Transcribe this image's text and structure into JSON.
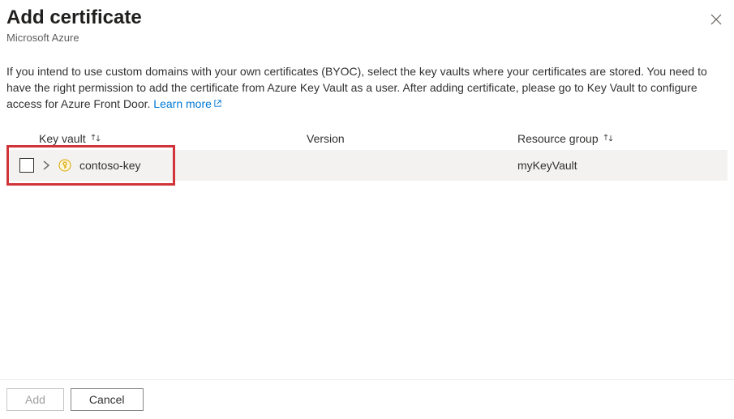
{
  "header": {
    "title": "Add certificate",
    "subtitle": "Microsoft Azure"
  },
  "description": {
    "text": "If you intend to use custom domains with your own certificates (BYOC), select the key vaults where your certificates are stored. You need to have the right permission to add the certificate from Azure Key Vault as a user. After adding certificate, please go to Key Vault to configure access for Azure Front Door. ",
    "link_label": "Learn more"
  },
  "table": {
    "columns": {
      "key_vault": "Key vault",
      "version": "Version",
      "resource_group": "Resource group"
    },
    "rows": [
      {
        "name": "contoso-key",
        "version": "",
        "resource_group": "myKeyVault"
      }
    ]
  },
  "footer": {
    "add_label": "Add",
    "cancel_label": "Cancel"
  }
}
